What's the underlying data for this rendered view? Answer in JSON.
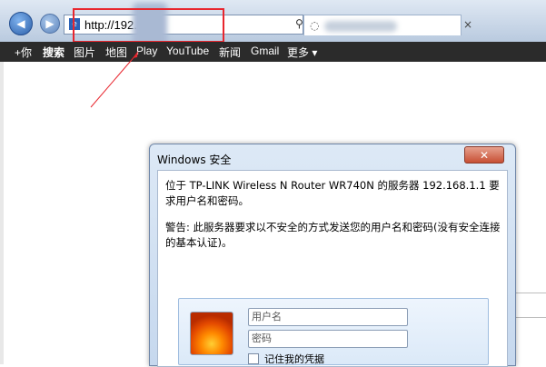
{
  "browser": {
    "address_url": "http://192.    1/",
    "address_icons": [
      "search-icon",
      "lock-icon",
      "refresh-icon",
      "close-icon"
    ],
    "tab_close": "×"
  },
  "nav": {
    "items": [
      "+你",
      "搜索",
      "图片",
      "地图",
      "Play",
      "YouTube",
      "新闻",
      "Gmail",
      "更多 ▾"
    ],
    "active_index": 1
  },
  "dialog": {
    "title": "Windows 安全",
    "close_label": "✕",
    "message1": "位于 TP-LINK Wireless N Router WR740N 的服务器 192.168.1.1 要求用户名和密码。",
    "message2": "警告: 此服务器要求以不安全的方式发送您的用户名和密码(没有安全连接的基本认证)。",
    "username_placeholder": "用户名",
    "password_placeholder": "密码",
    "remember_label": "记住我的凭据"
  },
  "colors": {
    "highlight": "#e8262e",
    "nav_bg": "#2b2b2b"
  }
}
